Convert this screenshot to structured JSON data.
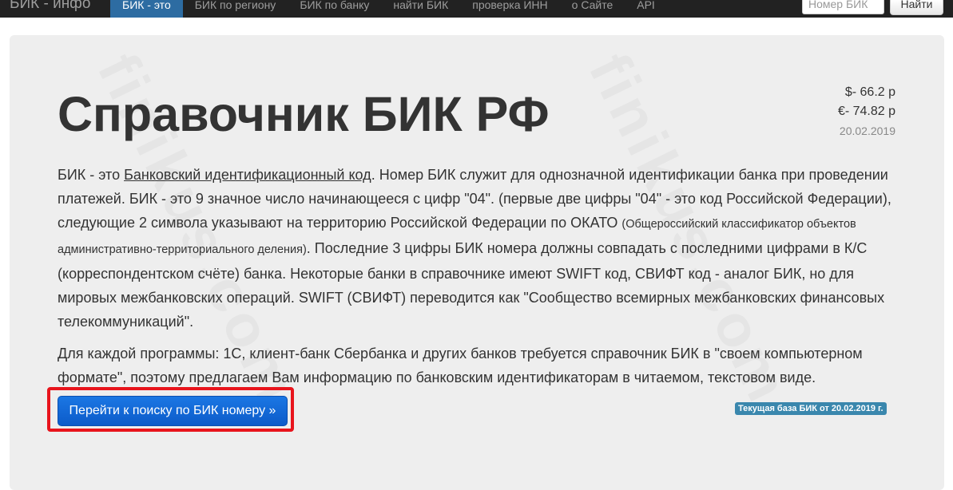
{
  "navbar": {
    "brand": "БИК - инфо",
    "items": [
      {
        "label": "БИК - это",
        "active": true
      },
      {
        "label": "БИК по региону",
        "active": false
      },
      {
        "label": "БИК по банку",
        "active": false
      },
      {
        "label": "найти БИК",
        "active": false
      },
      {
        "label": "проверка ИНН",
        "active": false
      },
      {
        "label": "о Сайте",
        "active": false
      },
      {
        "label": "API",
        "active": false
      }
    ],
    "search_placeholder": "Номер БИК",
    "search_button": "Найти"
  },
  "main": {
    "title": "Справочник БИК РФ",
    "rates": {
      "usd": "$- 66.2 р",
      "eur": "€- 74.82 р",
      "date": "20.02.2019"
    },
    "para1": {
      "t1": "БИК - это ",
      "link": "Банковский идентификационный код",
      "t2": ". Номер БИК служит для однозначной идентификации банка при проведении платежей. БИК - это 9 значное число начинающееся с цифр \"04\". (первые две цифры \"04\" - это код Российской Федерации), следующие 2 символа указывают на территорию Российской Федерации по ОКАТО ",
      "small": "(Общероссийский классификатор объектов административно-территориального деления)",
      "t3": ". Последние 3 цифры БИК номера должны совпадать с последними цифрами в К/С (корреспондентском счёте) банка. Некоторые банки в справочнике имеют SWIFT код, СВИФТ код - аналог БИК, но для мировых межбанковских операций. SWIFT (СВИФТ) переводится как \"Сообщество всемирных межбанковских финансовых телекоммуникаций\"."
    },
    "para2": "Для каждой программы: 1С, клиент-банк Сбербанка и других банков требуется справочник БИК в \"своем компьютерном формате\", поэтому предлагаем Вам информацию по банковским идентификаторам в читаемом, текстовом виде.",
    "cta_button": "Перейти к поиску по БИК номеру »",
    "db_label": "Текущая база БИК от 20.02.2019 г.",
    "watermark": "finikus.com"
  },
  "colors": {
    "navbar_bg": "#222222",
    "nav_active": "#2d6ca2",
    "jumbotron_bg": "#eeeeee",
    "cta_bg": "#1b77e4",
    "highlight_border": "#e8141c",
    "label_bg": "#3a87ad"
  }
}
